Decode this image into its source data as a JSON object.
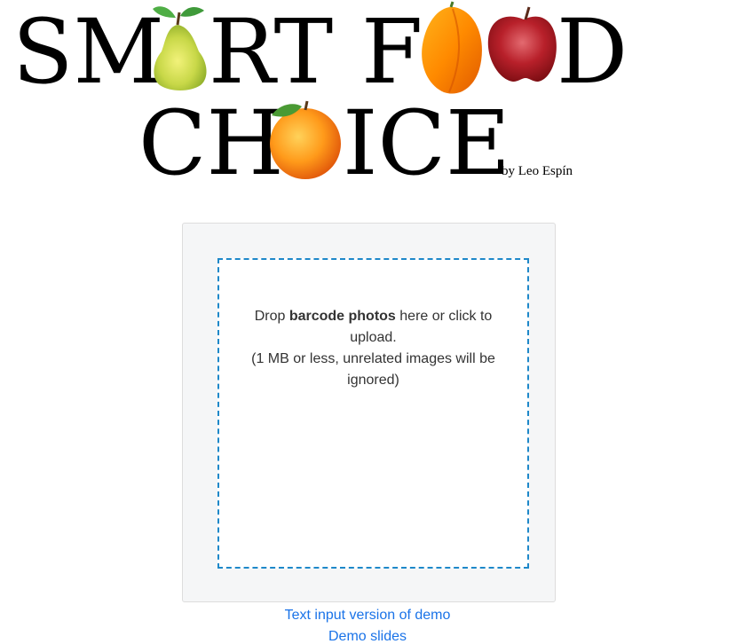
{
  "logo": {
    "row1_parts": [
      "SM",
      "RT F",
      "",
      "D"
    ],
    "row2_parts": [
      "CH",
      "ICE"
    ],
    "byline": "by Leo Espín",
    "title_text": "SMART FOOD CHOICE"
  },
  "dropzone": {
    "line1_pre": "Drop ",
    "line1_bold": "barcode photos",
    "line1_post": " here or click to upload.",
    "line2": "(1 MB or less, unrelated images will be ignored)",
    "border_color": "#1e88c9"
  },
  "links": {
    "text_demo": "Text input version of demo",
    "slides": "Demo slides"
  },
  "colors": {
    "link": "#1a73e8",
    "card_bg": "#f5f6f7"
  }
}
